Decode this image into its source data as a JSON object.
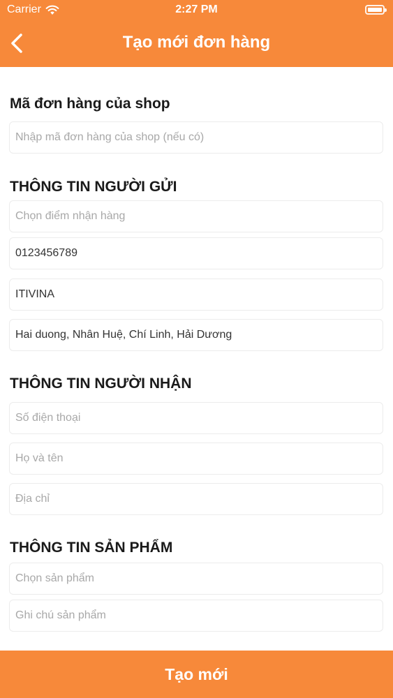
{
  "status_bar": {
    "carrier": "Carrier",
    "time": "2:27 PM"
  },
  "nav": {
    "title": "Tạo mới đơn hàng"
  },
  "shop_order": {
    "label": "Mã đơn hàng của shop",
    "placeholder": "Nhập mã đơn hàng của shop (nếu có)",
    "value": ""
  },
  "sender": {
    "label": "THÔNG TIN NGƯỜI GỬI",
    "pickup_placeholder": "Chọn điểm nhận hàng",
    "phone": "0123456789",
    "name": "ITIVINA",
    "address": "Hai duong, Nhân Huệ, Chí Linh, Hải Dương"
  },
  "receiver": {
    "label": "THÔNG TIN NGƯỜI NHẬN",
    "phone_placeholder": "Số điện thoại",
    "name_placeholder": "Họ và tên",
    "address_placeholder": "Địa chỉ"
  },
  "product": {
    "label": "THÔNG TIN SẢN PHẨM",
    "select_placeholder": "Chọn sản phẩm",
    "note_placeholder": "Ghi chú sản phẩm"
  },
  "footer": {
    "submit_label": "Tạo mới"
  },
  "colors": {
    "accent": "#F7893A",
    "text": "#1a1a1a",
    "placeholder": "#a8a8a8",
    "border": "#ececec"
  }
}
